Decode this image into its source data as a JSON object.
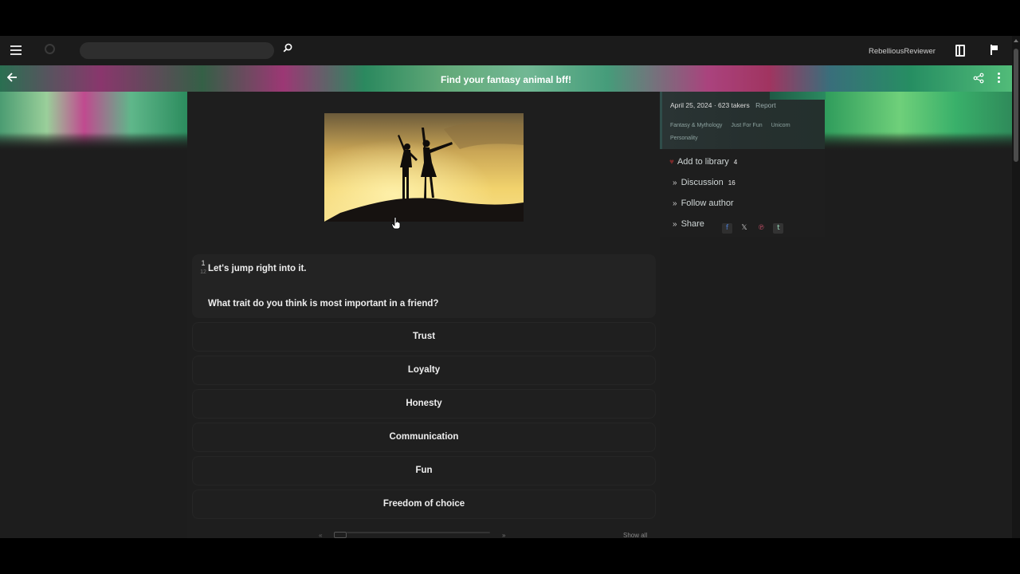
{
  "header": {
    "search_placeholder": "",
    "search_value": "",
    "username": "RebelliousReviewer"
  },
  "banner": {
    "title": "Find your fantasy animal bff!"
  },
  "quiz": {
    "question_number": "1",
    "question_total": "12",
    "intro": "Let's jump right into it.",
    "question": "What trait do you think is most important in a friend?",
    "answers": [
      "Trust",
      "Loyalty",
      "Honesty",
      "Communication",
      "Fun",
      "Freedom of choice"
    ],
    "pager_prev": "«",
    "pager_next": "»",
    "show_all": "Show all"
  },
  "sidebar": {
    "date_takers": "April 25, 2024 · 623 takers",
    "report": "Report",
    "tags": [
      "Fantasy & Mythology",
      "Just For Fun",
      "Unicorn",
      "Personality"
    ],
    "add_to_library": "Add to library",
    "library_count": "4",
    "discussion": "Discussion",
    "discussion_count": "16",
    "follow_author": "Follow author",
    "share": "Share",
    "share_icons": [
      "facebook-icon",
      "x-icon",
      "pinterest-icon",
      "tumblr-icon"
    ]
  },
  "colors": {
    "background": "#1d1d1d",
    "topbar": "#1b1b1b",
    "card": "#232323",
    "text": "#e6e6e6"
  }
}
